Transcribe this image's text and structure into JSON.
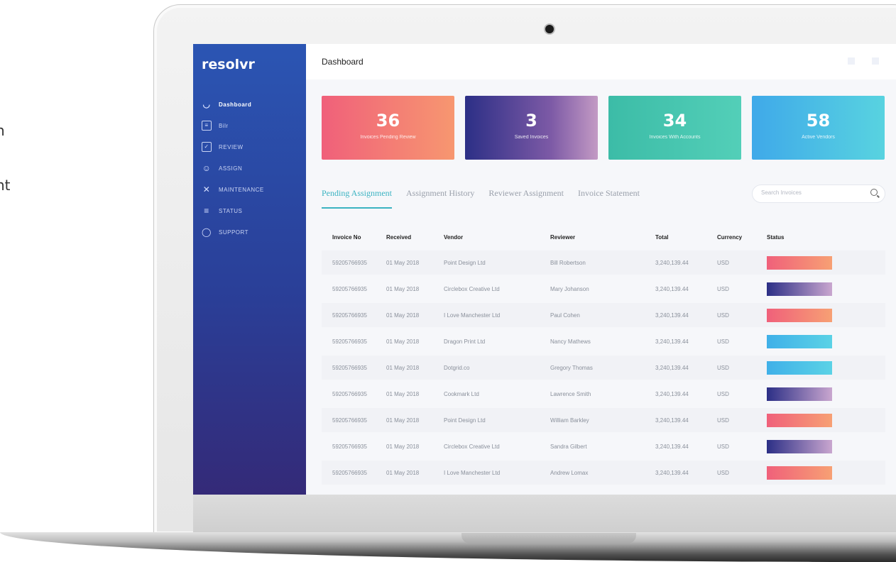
{
  "background_fragments": [
    "n",
    "nt"
  ],
  "app": {
    "brand": "resolvr",
    "page_title": "Dashboard"
  },
  "sidebar": {
    "items": [
      {
        "label": "Dashboard",
        "icon": "gauge-icon",
        "active": true
      },
      {
        "label": "Bilr",
        "icon": "document-icon",
        "active": false
      },
      {
        "label": "REVIEW",
        "icon": "checkbox-icon",
        "active": false
      },
      {
        "label": "ASSIGN",
        "icon": "user-icon",
        "active": false
      },
      {
        "label": "MAINTENANCE",
        "icon": "tools-icon",
        "active": false
      },
      {
        "label": "STATUS",
        "icon": "list-icon",
        "active": false
      },
      {
        "label": "SUPPORT",
        "icon": "chat-bubble-icon",
        "active": false
      }
    ]
  },
  "cards": [
    {
      "number": "36",
      "label": "Invoices Pending Review"
    },
    {
      "number": "3",
      "label": "Saved Invoices"
    },
    {
      "number": "34",
      "label": "Invoices With Accounts"
    },
    {
      "number": "58",
      "label": "Active Vendors"
    }
  ],
  "tabs": [
    {
      "label": "Pending Assignment",
      "active": true
    },
    {
      "label": "Assignment History",
      "active": false
    },
    {
      "label": "Reviewer Assignment",
      "active": false
    },
    {
      "label": "Invoice Statement",
      "active": false
    }
  ],
  "search": {
    "placeholder": "Search Invoices",
    "icon": "search-icon"
  },
  "table": {
    "headers": {
      "invoice_no": "Invoice No",
      "received": "Received",
      "vendor": "Vendor",
      "reviewer": "Reviewer",
      "total": "Total",
      "currency": "Currency",
      "status": "Status"
    },
    "rows": [
      {
        "invoice_no": "59205766935",
        "received": "01 May 2018",
        "vendor": "Point Design Ltd",
        "reviewer": "Bill Robertson",
        "total": "3,240,139.44",
        "currency": "USD",
        "status": "pending"
      },
      {
        "invoice_no": "59205766935",
        "received": "01 May 2018",
        "vendor": "Circlebox Creative Ltd",
        "reviewer": "Mary Johanson",
        "total": "3,240,139.44",
        "currency": "USD",
        "status": "saved"
      },
      {
        "invoice_no": "59205766935",
        "received": "01 May 2018",
        "vendor": "I Love Manchester Ltd",
        "reviewer": "Paul Cohen",
        "total": "3,240,139.44",
        "currency": "USD",
        "status": "pending"
      },
      {
        "invoice_no": "59205766935",
        "received": "01 May 2018",
        "vendor": "Dragon Print Ltd",
        "reviewer": "Nancy Mathews",
        "total": "3,240,139.44",
        "currency": "USD",
        "status": "active"
      },
      {
        "invoice_no": "59205766935",
        "received": "01 May 2018",
        "vendor": "Dotgrid.co",
        "reviewer": "Gregory Thomas",
        "total": "3,240,139.44",
        "currency": "USD",
        "status": "active"
      },
      {
        "invoice_no": "59205766935",
        "received": "01 May 2018",
        "vendor": "Cookmark Ltd",
        "reviewer": "Lawrence Smith",
        "total": "3,240,139.44",
        "currency": "USD",
        "status": "saved"
      },
      {
        "invoice_no": "59205766935",
        "received": "01 May 2018",
        "vendor": "Point Design Ltd",
        "reviewer": "William Barkley",
        "total": "3,240,139.44",
        "currency": "USD",
        "status": "pending"
      },
      {
        "invoice_no": "59205766935",
        "received": "01 May 2018",
        "vendor": "Circlebox Creative Ltd",
        "reviewer": "Sandra Gilbert",
        "total": "3,240,139.44",
        "currency": "USD",
        "status": "saved"
      },
      {
        "invoice_no": "59205766935",
        "received": "01 May 2018",
        "vendor": "I Love Manchester Ltd",
        "reviewer": "Andrew Lomax",
        "total": "3,240,139.44",
        "currency": "USD",
        "status": "pending"
      }
    ]
  },
  "colors": {
    "accent": "#3bb3c2",
    "sidebar_top": "#2b55b3",
    "sidebar_bottom": "#342a78"
  }
}
